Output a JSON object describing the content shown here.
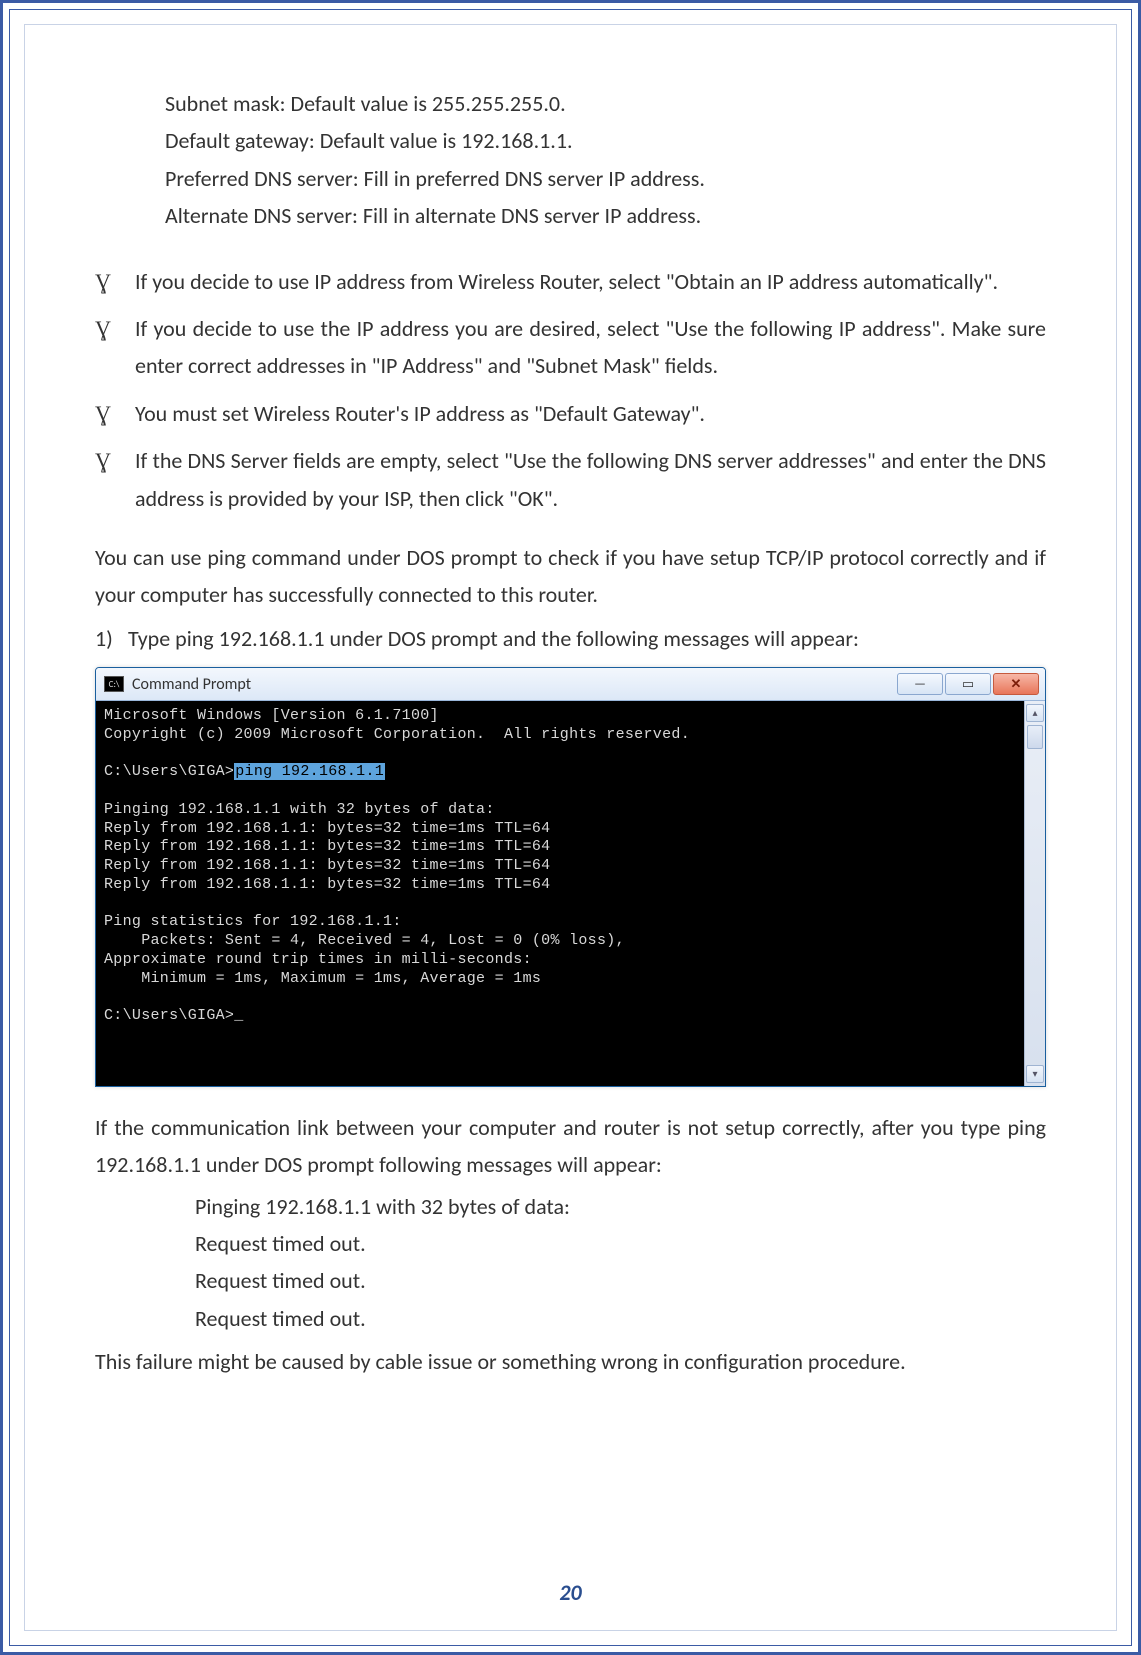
{
  "intro_lines": [
    "Subnet mask: Default value is 255.255.255.0.",
    "Default gateway: Default value is 192.168.1.1.",
    "Preferred DNS server: Fill in preferred DNS server IP address.",
    "Alternate DNS server: Fill in alternate DNS server IP address."
  ],
  "bullet_glyph": "Ɣ",
  "bullets": [
    "If you decide to use IP address from Wireless Router, select \"Obtain an IP address automatically\".",
    "If you decide to use the IP address you are desired, select \"Use the following IP address\". Make sure enter correct addresses in \"IP Address\" and \"Subnet Mask\" fields.",
    "You must set Wireless Router's IP address as \"Default Gateway\".",
    "If the DNS Server fields are empty, select \"Use the following DNS server addresses\" and enter the DNS address is provided by your ISP, then click \"OK\"."
  ],
  "ping_intro": "You can use ping command under DOS prompt to check if you have setup TCP/IP protocol correctly and if your computer has successfully connected to this router.",
  "step1": {
    "num": "1)",
    "text": "Type ping 192.168.1.1 under DOS prompt and the following messages will appear:"
  },
  "cmd": {
    "icon_text": "C:\\",
    "title": "Command Prompt",
    "min_glyph": "—",
    "max_glyph": "▭",
    "close_glyph": "✕",
    "up_glyph": "▴",
    "down_glyph": "▾",
    "line1": "Microsoft Windows [Version 6.1.7100]",
    "line2": "Copyright (c) 2009 Microsoft Corporation.  All rights reserved.",
    "prompt_prefix": "C:\\Users\\GIGA>",
    "prompt_cmd": "ping 192.168.1.1",
    "ping_hdr": "Pinging 192.168.1.1 with 32 bytes of data:",
    "reply1": "Reply from 192.168.1.1: bytes=32 time=1ms TTL=64",
    "reply2": "Reply from 192.168.1.1: bytes=32 time=1ms TTL=64",
    "reply3": "Reply from 192.168.1.1: bytes=32 time=1ms TTL=64",
    "reply4": "Reply from 192.168.1.1: bytes=32 time=1ms TTL=64",
    "stats_hdr": "Ping statistics for 192.168.1.1:",
    "stats_pkts": "    Packets: Sent = 4, Received = 4, Lost = 0 (0% loss),",
    "stats_rt_hdr": "Approximate round trip times in milli-seconds:",
    "stats_rt": "    Minimum = 1ms, Maximum = 1ms, Average = 1ms",
    "idle_prompt": "C:\\Users\\GIGA>_"
  },
  "fail_intro": "If the communication link between your computer and router is not setup correctly, after you type ping 192.168.1.1 under DOS prompt following messages will appear:",
  "fail_lines": [
    "Pinging 192.168.1.1 with 32 bytes of data:",
    "Request timed out.",
    "Request timed out.",
    "Request timed out."
  ],
  "fail_note": "This failure might be caused by cable issue or something wrong in configuration procedure.",
  "page_number": "20"
}
